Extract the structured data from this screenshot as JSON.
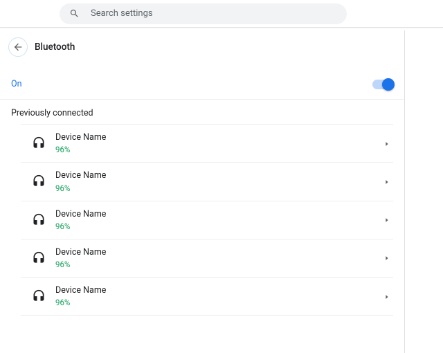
{
  "search": {
    "placeholder": "Search settings"
  },
  "header": {
    "title": "Bluetooth"
  },
  "bluetooth": {
    "status_label": "On",
    "enabled": true
  },
  "section": {
    "title": "Previously connected"
  },
  "devices": [
    {
      "name": "Device Name",
      "battery": "96%"
    },
    {
      "name": "Device Name",
      "battery": "96%"
    },
    {
      "name": "Device Name",
      "battery": "96%"
    },
    {
      "name": "Device Name",
      "battery": "96%"
    },
    {
      "name": "Device Name",
      "battery": "96%"
    }
  ],
  "colors": {
    "accent": "#1a73e8",
    "success": "#0f9d58"
  }
}
